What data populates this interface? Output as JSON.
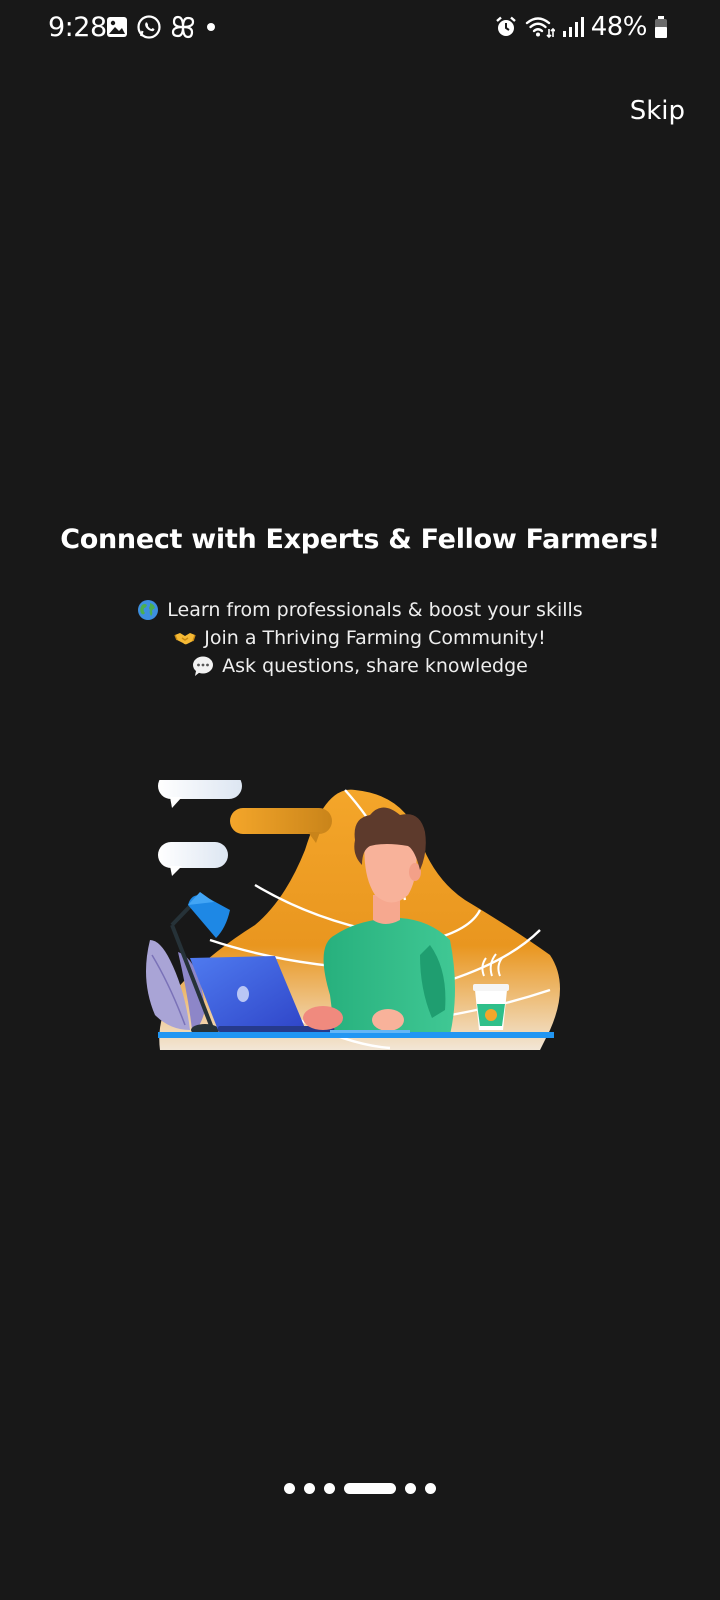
{
  "status_bar": {
    "time": "9:28",
    "battery_percent": "48%",
    "left_icons": [
      "gallery-icon",
      "whatsapp-icon",
      "pinwheel-icon",
      "dot-icon"
    ],
    "right_icons": [
      "alarm-icon",
      "wifi-icon",
      "signal-icon",
      "battery-icon"
    ]
  },
  "header": {
    "skip_label": "Skip"
  },
  "onboarding": {
    "title": "Connect with Experts & Fellow Farmers!",
    "bullets": [
      {
        "icon": "globe-icon",
        "text": "Learn from professionals & boost your skills"
      },
      {
        "icon": "handshake-icon",
        "text": "Join a Thriving Farming Community!"
      },
      {
        "icon": "speech-bubble-icon",
        "text": "Ask questions, share knowledge"
      }
    ]
  },
  "pager": {
    "total_pages": 6,
    "active_index": 3
  },
  "colors": {
    "background": "#181818",
    "accent_orange": "#f4a62a",
    "shirt_green": "#2fbf8a",
    "laptop_blue": "#3a5bd9"
  }
}
